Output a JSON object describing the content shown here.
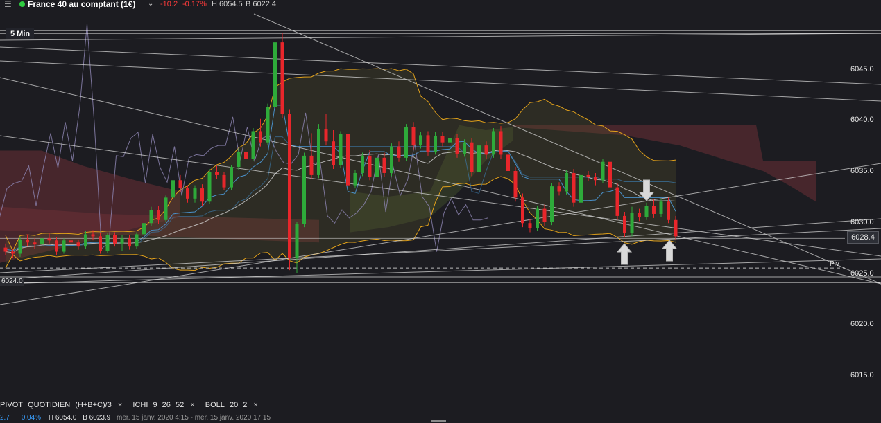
{
  "header": {
    "menu_icon": "hamburger-icon",
    "status_color": "#2ecc40",
    "instrument": "France 40 au comptant (1€)",
    "chevron": "⌄",
    "change": "-10.2",
    "change_pct": "-0.17%",
    "high": "H 6054.5",
    "low": "B 6022.4",
    "down_color": "#ff3b3b"
  },
  "timeframe": "5 Min",
  "price_label": "6028.4",
  "left_price_label": "6024.0",
  "pivot_label": "Piv",
  "legend": {
    "pivot": "PIVOT",
    "pivot_period": "QUOTIDIEN",
    "pivot_formula": "(H+B+C)/3",
    "ichi": "ICHI",
    "ichi_params": [
      "9",
      "26",
      "52"
    ],
    "boll": "BOLL",
    "boll_params": [
      "20",
      "2"
    ],
    "close_mark": "×"
  },
  "info_bar": {
    "v1": "2.7",
    "v2": "0.04%",
    "high": "H 6054.0",
    "low": "B 6023.9",
    "range": "mer. 15 janv. 2020 4:15 - mer. 15 janv. 2020 17:15"
  },
  "chart_data": {
    "type": "candlestick",
    "ylim": [
      6013,
      6050
    ],
    "yticks": [
      6015.0,
      6020.0,
      6025.0,
      6030.0,
      6035.0,
      6040.0,
      6045.0
    ],
    "last_price": 6028.4,
    "pivot": 6025.5,
    "colors": {
      "up": "#2eaa3a",
      "down": "#e8262b",
      "boll": "#e3a21a",
      "ichimoku_mid": "#4a90c8",
      "lagging": "#8c84b0",
      "cloud_bear": "#6b2f36",
      "cloud_bull": "#3e4a2c"
    },
    "candles": [
      [
        6027.5,
        6027.9,
        6026.8,
        6027.1
      ],
      [
        6027.1,
        6027.4,
        6026.5,
        6026.9
      ],
      [
        6026.9,
        6028.6,
        6026.6,
        6028.3
      ],
      [
        6028.3,
        6028.8,
        6027.6,
        6028.0
      ],
      [
        6028.0,
        6028.4,
        6027.4,
        6027.8
      ],
      [
        6027.8,
        6028.6,
        6027.5,
        6028.4
      ],
      [
        6028.4,
        6028.9,
        6027.9,
        6028.2
      ],
      [
        6028.2,
        6028.5,
        6026.8,
        6027.1
      ],
      [
        6027.1,
        6028.4,
        6026.9,
        6028.2
      ],
      [
        6028.2,
        6028.7,
        6027.7,
        6028.0
      ],
      [
        6028.0,
        6028.3,
        6027.3,
        6027.6
      ],
      [
        6027.6,
        6029.1,
        6027.4,
        6028.8
      ],
      [
        6028.8,
        6029.2,
        6028.2,
        6028.6
      ],
      [
        6028.6,
        6028.9,
        6026.9,
        6027.2
      ],
      [
        6027.2,
        6028.9,
        6027.0,
        6028.7
      ],
      [
        6028.7,
        6029.0,
        6027.6,
        6027.9
      ],
      [
        6027.9,
        6028.7,
        6027.2,
        6028.4
      ],
      [
        6028.4,
        6028.7,
        6027.3,
        6027.6
      ],
      [
        6027.6,
        6029.0,
        6027.4,
        6028.8
      ],
      [
        6028.8,
        6030.2,
        6028.5,
        6029.9
      ],
      [
        6029.9,
        6031.5,
        6029.6,
        6031.2
      ],
      [
        6031.2,
        6031.6,
        6029.8,
        6030.2
      ],
      [
        6030.2,
        6032.6,
        6030.0,
        6032.4
      ],
      [
        6032.4,
        6034.4,
        6032.1,
        6034.1
      ],
      [
        6034.1,
        6034.6,
        6032.9,
        6033.3
      ],
      [
        6033.3,
        6033.6,
        6031.9,
        6032.3
      ],
      [
        6032.3,
        6033.6,
        6031.9,
        6033.3
      ],
      [
        6033.3,
        6033.7,
        6031.6,
        6032.0
      ],
      [
        6032.0,
        6035.2,
        6031.8,
        6034.9
      ],
      [
        6034.9,
        6035.5,
        6034.2,
        6034.6
      ],
      [
        6034.6,
        6034.9,
        6033.1,
        6033.4
      ],
      [
        6033.4,
        6035.6,
        6033.1,
        6035.4
      ],
      [
        6035.4,
        6037.2,
        6035.1,
        6036.9
      ],
      [
        6036.9,
        6037.6,
        6035.8,
        6036.2
      ],
      [
        6036.2,
        6039.2,
        6036.0,
        6038.9
      ],
      [
        6038.9,
        6040.1,
        6037.4,
        6037.8
      ],
      [
        6037.8,
        6041.6,
        6037.5,
        6041.3
      ],
      [
        6041.3,
        6049.8,
        6041.0,
        6047.6
      ],
      [
        6047.6,
        6048.5,
        6040.2,
        6040.6
      ],
      [
        6040.6,
        6041.0,
        6025.3,
        6026.5
      ],
      [
        6026.5,
        6030.0,
        6025.0,
        6029.8
      ],
      [
        6029.8,
        6036.8,
        6029.5,
        6036.5
      ],
      [
        6036.5,
        6038.7,
        6034.2,
        6034.6
      ],
      [
        6034.6,
        6039.6,
        6034.3,
        6039.1
      ],
      [
        6039.1,
        6040.6,
        6037.5,
        6037.9
      ],
      [
        6037.9,
        6039.0,
        6035.2,
        6035.6
      ],
      [
        6035.6,
        6038.9,
        6035.3,
        6038.6
      ],
      [
        6038.6,
        6039.8,
        6033.2,
        6033.6
      ],
      [
        6033.6,
        6035.1,
        6033.3,
        6034.8
      ],
      [
        6034.8,
        6036.8,
        6034.5,
        6036.5
      ],
      [
        6036.5,
        6037.1,
        6034.1,
        6034.4
      ],
      [
        6034.4,
        6036.6,
        6034.1,
        6036.3
      ],
      [
        6036.3,
        6036.8,
        6034.4,
        6034.8
      ],
      [
        6034.8,
        6037.7,
        6034.5,
        6037.4
      ],
      [
        6037.4,
        6037.9,
        6035.9,
        6036.3
      ],
      [
        6036.3,
        6039.6,
        6036.0,
        6039.3
      ],
      [
        6039.3,
        6039.8,
        6037.1,
        6037.5
      ],
      [
        6037.5,
        6038.8,
        6037.2,
        6038.5
      ],
      [
        6038.5,
        6038.9,
        6036.5,
        6036.9
      ],
      [
        6036.9,
        6038.8,
        6036.6,
        6038.4
      ],
      [
        6038.4,
        6038.8,
        6037.4,
        6037.8
      ],
      [
        6037.8,
        6038.5,
        6037.5,
        6038.2
      ],
      [
        6038.2,
        6038.6,
        6036.3,
        6036.7
      ],
      [
        6036.7,
        6038.1,
        6036.4,
        6037.8
      ],
      [
        6037.8,
        6038.2,
        6034.5,
        6034.9
      ],
      [
        6034.9,
        6037.8,
        6034.6,
        6037.5
      ],
      [
        6037.5,
        6037.9,
        6036.2,
        6036.6
      ],
      [
        6036.6,
        6039.2,
        6036.3,
        6038.9
      ],
      [
        6038.9,
        6039.4,
        6036.2,
        6036.6
      ],
      [
        6036.6,
        6037.0,
        6034.6,
        6035.0
      ],
      [
        6035.0,
        6035.4,
        6032.0,
        6032.4
      ],
      [
        6032.4,
        6032.8,
        6029.5,
        6029.9
      ],
      [
        6029.9,
        6030.3,
        6029.0,
        6029.4
      ],
      [
        6029.4,
        6031.6,
        6029.1,
        6031.3
      ],
      [
        6031.3,
        6031.7,
        6029.6,
        6030.0
      ],
      [
        6030.0,
        6033.8,
        6029.7,
        6033.5
      ],
      [
        6033.5,
        6033.9,
        6032.6,
        6033.0
      ],
      [
        6033.0,
        6035.1,
        6032.7,
        6034.8
      ],
      [
        6034.8,
        6035.2,
        6031.5,
        6031.9
      ],
      [
        6031.9,
        6035.0,
        6031.6,
        6034.6
      ],
      [
        6034.6,
        6035.0,
        6034.0,
        6034.4
      ],
      [
        6034.4,
        6034.8,
        6033.6,
        6034.1
      ],
      [
        6034.1,
        6036.2,
        6033.8,
        6035.9
      ],
      [
        6035.9,
        6036.3,
        6033.0,
        6033.4
      ],
      [
        6033.4,
        6033.8,
        6030.2,
        6030.6
      ],
      [
        6030.6,
        6031.0,
        6028.5,
        6028.9
      ],
      [
        6028.9,
        6031.5,
        6028.6,
        6030.9
      ],
      [
        6030.9,
        6031.3,
        6030.1,
        6030.5
      ],
      [
        6030.5,
        6031.9,
        6030.2,
        6031.6
      ],
      [
        6031.6,
        6032.2,
        6030.4,
        6030.8
      ],
      [
        6030.8,
        6032.3,
        6030.5,
        6032.0
      ],
      [
        6032.0,
        6032.4,
        6029.9,
        6030.2
      ],
      [
        6030.2,
        6030.6,
        6028.3,
        6028.6
      ]
    ]
  }
}
